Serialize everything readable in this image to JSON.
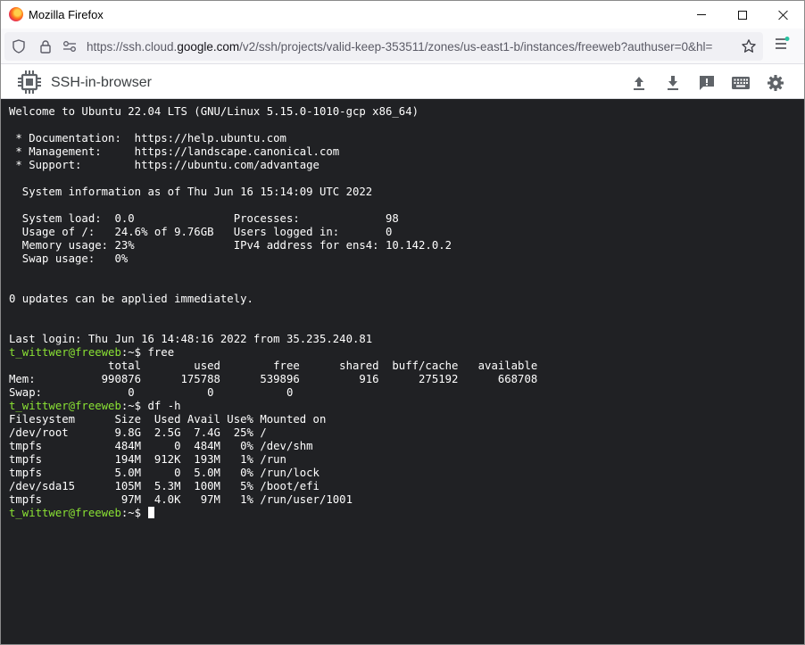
{
  "window": {
    "title": "Mozilla Firefox"
  },
  "browser": {
    "url_prefix": "https://ssh.cloud.",
    "url_domain": "google.com",
    "url_suffix": "/v2/ssh/projects/valid-keep-353511/zones/us-east1-b/instances/freeweb?authuser=0&hl="
  },
  "ssh": {
    "title": "SSH-in-browser"
  },
  "terminal": {
    "lines": [
      "Welcome to Ubuntu 22.04 LTS (GNU/Linux 5.15.0-1010-gcp x86_64)",
      "",
      " * Documentation:  https://help.ubuntu.com",
      " * Management:     https://landscape.canonical.com",
      " * Support:        https://ubuntu.com/advantage",
      "",
      "  System information as of Thu Jun 16 15:14:09 UTC 2022",
      "",
      "  System load:  0.0               Processes:             98",
      "  Usage of /:   24.6% of 9.76GB   Users logged in:       0",
      "  Memory usage: 23%               IPv4 address for ens4: 10.142.0.2",
      "  Swap usage:   0%",
      "",
      "",
      "0 updates can be applied immediately.",
      "",
      "",
      "Last login: Thu Jun 16 14:48:16 2022 from 35.235.240.81"
    ],
    "prompt_user": "t_wittwer@freeweb",
    "prompt_suffix": ":~$ ",
    "cmd_free": "free",
    "free_output": [
      "               total        used        free      shared  buff/cache   available",
      "Mem:          990876      175788      539896         916      275192      668708",
      "Swap:             0           0           0"
    ],
    "cmd_df": "df -h",
    "df_output": [
      "Filesystem      Size  Used Avail Use% Mounted on",
      "/dev/root       9.8G  2.5G  7.4G  25% /",
      "tmpfs           484M     0  484M   0% /dev/shm",
      "tmpfs           194M  912K  193M   1% /run",
      "tmpfs           5.0M     0  5.0M   0% /run/lock",
      "/dev/sda15      105M  5.3M  100M   5% /boot/efi",
      "tmpfs            97M  4.0K   97M   1% /run/user/1001"
    ]
  }
}
